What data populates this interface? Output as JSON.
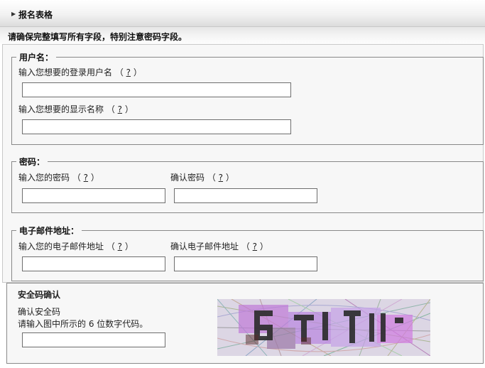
{
  "header": {
    "title": "报名表格"
  },
  "notice": "请确保完整填写所有字段，特别注意密码字段。",
  "help_text": "?",
  "username_section": {
    "legend": "用户名：",
    "login_label": "输入您想要的登录用户名",
    "display_label": "输入您想要的显示名称"
  },
  "password_section": {
    "legend": "密码：",
    "password_label": "输入您的密码",
    "confirm_label": "确认密码"
  },
  "email_section": {
    "legend": "电子邮件地址：",
    "email_label": "输入您的电子邮件地址",
    "confirm_label": "确认电子邮件地址"
  },
  "captcha_section": {
    "title": "安全码确认",
    "label": "确认安全码",
    "hint": "请输入图中所示的 6 位数字代码。"
  },
  "colors": {
    "panel": "#f7f7f7",
    "border": "#888888",
    "captcha_text": "#2a2a2a"
  }
}
